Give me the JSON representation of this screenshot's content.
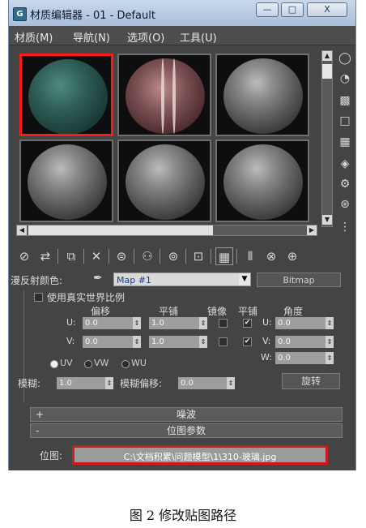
{
  "window": {
    "title": "材质编辑器 - 01 - Default",
    "app_icon": "3ds-max-logo-icon",
    "controls": {
      "minimize": "—",
      "maximize": "□",
      "close": "X"
    }
  },
  "menubar": {
    "items": [
      "材质(M)",
      "导航(N)",
      "选项(O)",
      "工具(U)"
    ]
  },
  "slots": [
    {
      "material": "green-marble",
      "selected": true
    },
    {
      "material": "striped-sphere",
      "selected": false
    },
    {
      "material": "default-gray",
      "selected": false
    },
    {
      "material": "default-gray",
      "selected": false
    },
    {
      "material": "default-gray",
      "selected": false
    },
    {
      "material": "default-gray",
      "selected": false
    }
  ],
  "side_tools": [
    "sample-type-icon",
    "backlight-icon",
    "background-icon",
    "sample-uv-tiling-icon",
    "video-color-check-icon",
    "make-preview-icon",
    "options-icon",
    "select-by-material-icon",
    "material-map-navigator-icon"
  ],
  "toolbar_icons": [
    "get-material-icon",
    "put-material-icon",
    "assign-material-icon",
    "reset-map-icon",
    "copy-material-icon",
    "make-unique-icon",
    "put-to-library-icon",
    "material-effects-channel-icon",
    "show-map-in-viewport-icon",
    "show-end-result-icon",
    "go-to-parent-icon",
    "go-forward-icon",
    "pick-material-icon"
  ],
  "map_row": {
    "label": "漫反射颜色:",
    "map_name": "Map #1",
    "map_type": "Bitmap"
  },
  "coords": {
    "real_world_label": "使用真实世界比例",
    "offset_label": "偏移",
    "tiling_label": "平铺",
    "mirror_label": "镜像",
    "tile_label": "平铺",
    "angle_label": "角度",
    "u_label": "U:",
    "v_label": "V:",
    "w_label": "W:",
    "u_offset": "0.0",
    "v_offset": "0.0",
    "u_tiling": "1.0",
    "v_tiling": "1.0",
    "u_mirror": false,
    "v_mirror": false,
    "u_tile": true,
    "v_tile": true,
    "u_angle": "0.0",
    "v_angle": "0.0",
    "w_angle": "0.0",
    "uvw_options": [
      "UV",
      "VW",
      "WU"
    ],
    "uvw_selected": "UV",
    "blur_label": "模糊:",
    "blur_value": "1.0",
    "blur_offset_label": "模糊偏移:",
    "blur_offset_value": "0.0",
    "rotate_label": "旋转"
  },
  "rollouts": {
    "noise_sign": "+",
    "noise_title": "噪波",
    "bitmap_sign": "-",
    "bitmap_title": "位图参数"
  },
  "bitmap": {
    "label": "位图:",
    "path": "C:\\文档积累\\问题模型\\1\\310-玻璃.jpg"
  },
  "caption": "图 2  修改贴图路径",
  "colors": {
    "highlight": "#d21a1a",
    "panel": "#444444"
  }
}
